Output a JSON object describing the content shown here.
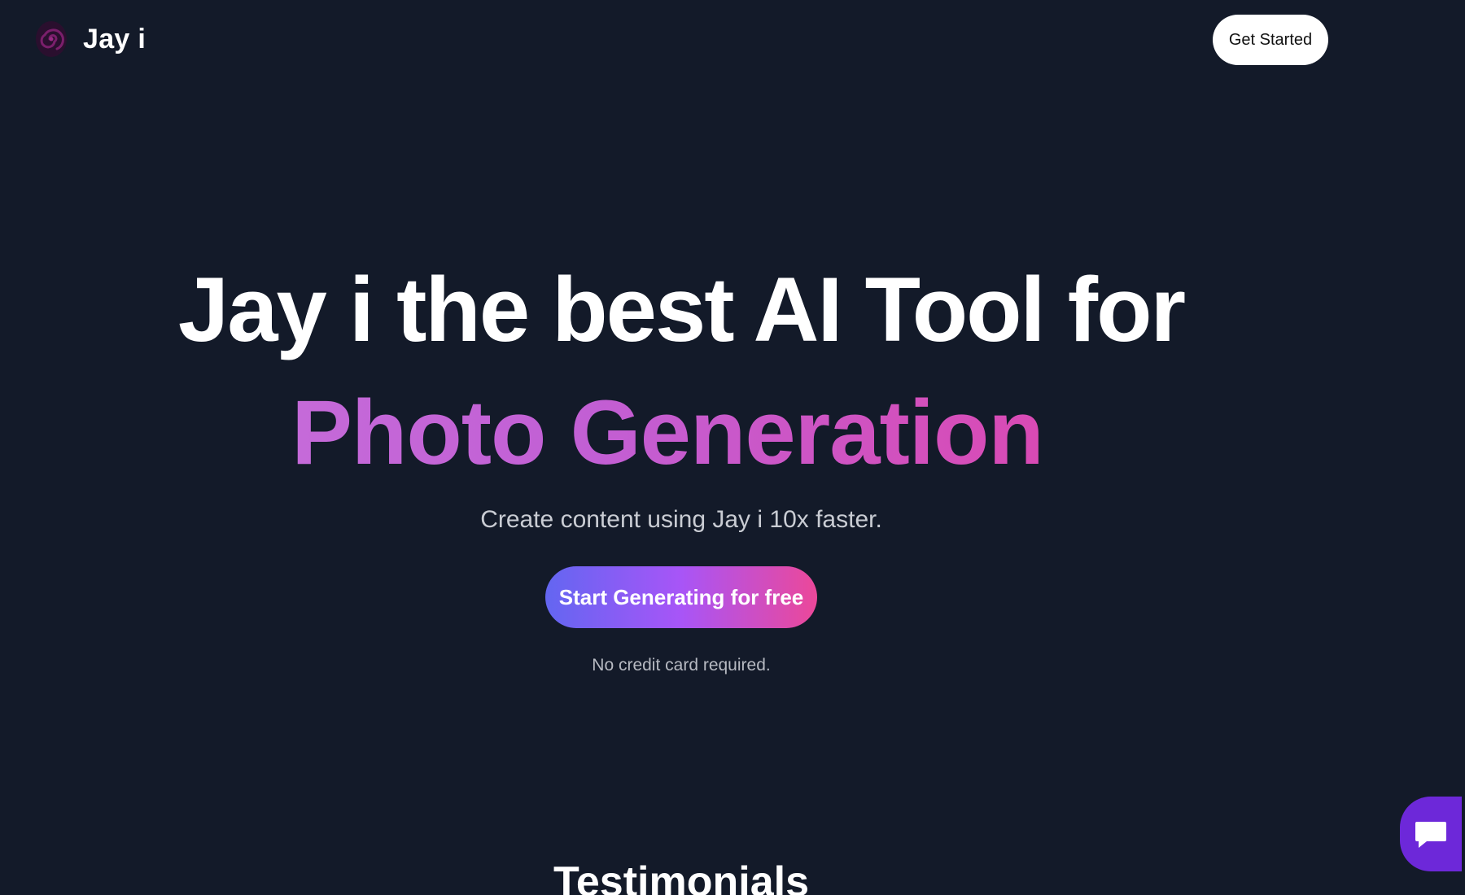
{
  "header": {
    "brand_name": "Jay i",
    "logo_icon": "spiral-logo-icon",
    "cta_label": "Get Started"
  },
  "hero": {
    "title_line1": "Jay i the best AI Tool for",
    "title_line2": "Photo Generation",
    "subtitle": "Create content using Jay i 10x faster.",
    "cta_label": "Start Generating for free",
    "note": "No credit card required."
  },
  "sections": {
    "testimonials_heading": "Testimonials"
  },
  "chat_widget": {
    "icon": "chat-bubble-icon"
  },
  "colors": {
    "background": "#131a29",
    "gradient_start": "#6366f1",
    "gradient_mid": "#a855f7",
    "gradient_end": "#ec4899",
    "highlight_text": "#c85fd0",
    "chat_widget": "#6d28d9"
  }
}
